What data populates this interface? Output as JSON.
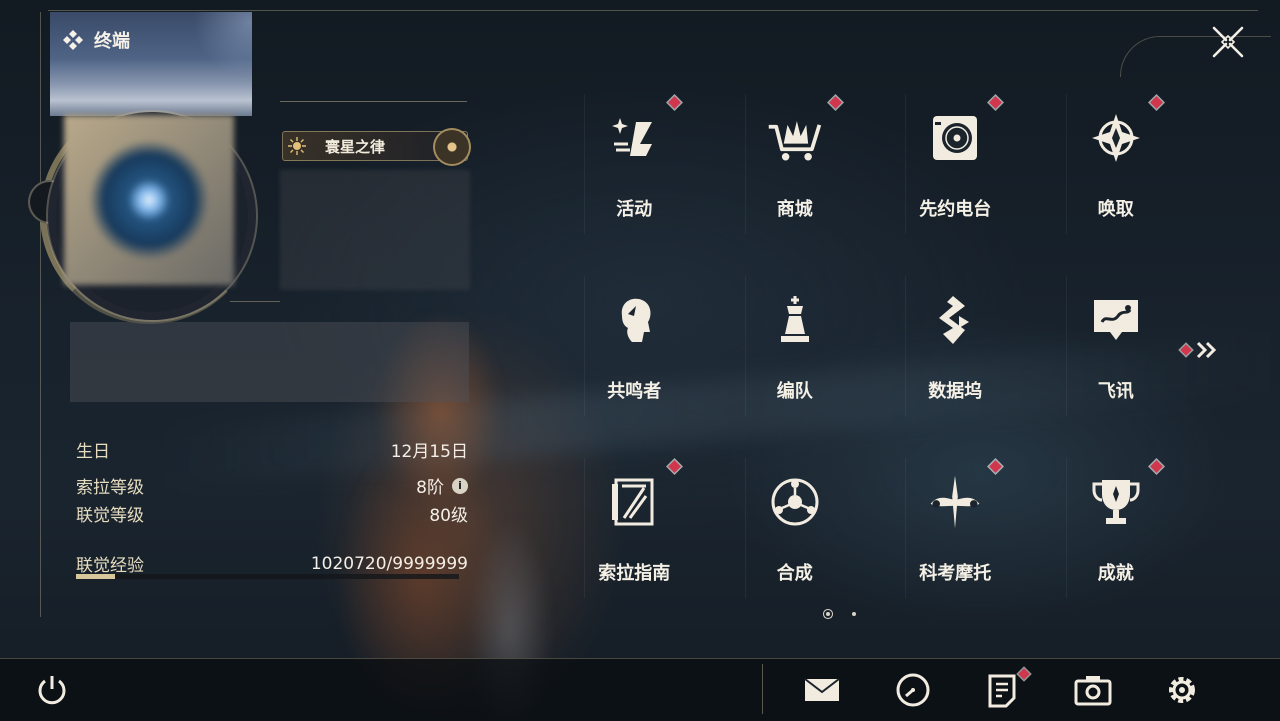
{
  "header": {
    "title": "终端"
  },
  "profile": {
    "title_badge": "寰星之律",
    "info": [
      {
        "label": "生日",
        "value": "12月15日"
      },
      {
        "label": "索拉等级",
        "value": "8阶",
        "info_icon": "i"
      },
      {
        "label": "联觉等级",
        "value": "80级"
      },
      {
        "label": "联觉经验",
        "value": "1020720/9999999",
        "progress": 0.102
      }
    ]
  },
  "menu": {
    "items": [
      {
        "label": "活动",
        "icon": "sparkle-icon",
        "badge": true
      },
      {
        "label": "商城",
        "icon": "shopping-cart-icon",
        "badge": true
      },
      {
        "label": "先约电台",
        "icon": "radio-icon",
        "badge": true
      },
      {
        "label": "唤取",
        "icon": "compass-star-icon",
        "badge": true
      },
      {
        "label": "共鸣者",
        "icon": "character-head-icon",
        "badge": false
      },
      {
        "label": "编队",
        "icon": "chess-piece-icon",
        "badge": false
      },
      {
        "label": "数据坞",
        "icon": "data-dock-icon",
        "badge": false
      },
      {
        "label": "飞讯",
        "icon": "chat-bubble-icon",
        "badge": false
      },
      {
        "label": "索拉指南",
        "icon": "guide-book-icon",
        "badge": true
      },
      {
        "label": "合成",
        "icon": "synthesis-icon",
        "badge": false
      },
      {
        "label": "科考摩托",
        "icon": "motorbike-icon",
        "badge": true
      },
      {
        "label": "成就",
        "icon": "trophy-icon",
        "badge": true
      }
    ],
    "pagination": {
      "pages": 2,
      "current": 1
    }
  },
  "bottom_bar": {
    "buttons": [
      {
        "name": "power",
        "icon": "power-icon"
      },
      {
        "name": "mail",
        "icon": "mail-icon"
      },
      {
        "name": "clock",
        "icon": "clock-icon"
      },
      {
        "name": "notice",
        "icon": "notice-icon",
        "badge": true
      },
      {
        "name": "camera",
        "icon": "camera-icon"
      },
      {
        "name": "settings",
        "icon": "gear-icon"
      }
    ]
  },
  "colors": {
    "accent_gold": "#d8c79a",
    "badge_red": "#d0374c",
    "text": "#f4f0e6"
  }
}
